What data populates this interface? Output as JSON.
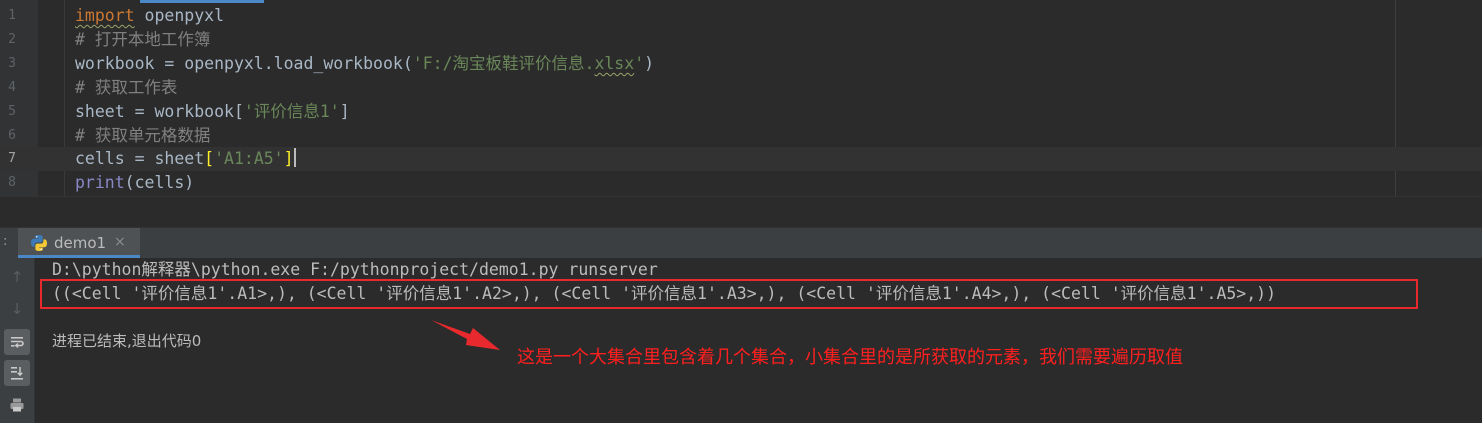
{
  "editor": {
    "lines": [
      {
        "num": "1"
      },
      {
        "num": "2",
        "text": "# 打开本地工作簿"
      },
      {
        "num": "3",
        "before": "workbook = openpyxl.load_workbook(",
        "str_a": "'F:/淘宝板鞋评价信息.",
        "str_b": "xlsx",
        "str_c": "'",
        "after": ")"
      },
      {
        "num": "4",
        "text": "# 获取工作表"
      },
      {
        "num": "5",
        "before": "sheet = workbook[",
        "str": "'评价信息1'",
        "after": "]"
      },
      {
        "num": "6",
        "text": "# 获取单元格数据"
      },
      {
        "num": "7",
        "before": "cells = sheet",
        "open": "[",
        "str": "'A1:A5'",
        "close": "]"
      },
      {
        "num": "8",
        "func": "print",
        "after": "(cells)"
      }
    ],
    "import_kw": "import",
    "import_mod": " openpyxl",
    "current_line": 7
  },
  "run_panel": {
    "colon": ":",
    "tab_label": "demo1",
    "tab_close": "×",
    "icon": "python-icon"
  },
  "toolbar": {
    "up": "↑",
    "down": "↓",
    "wrap": "soft-wrap-icon",
    "scroll_end": "scroll-to-end-icon",
    "print": "print-icon"
  },
  "console": {
    "command": "D:\\python解释器\\python.exe F:/pythonproject/demo1.py runserver",
    "result": "((<Cell '评价信息1'.A1>,), (<Cell '评价信息1'.A2>,), (<Cell '评价信息1'.A3>,), (<Cell '评价信息1'.A4>,), (<Cell '评价信息1'.A5>,))",
    "exit": "进程已结束,退出代码0"
  },
  "annotation": {
    "text": "这是一个大集合里包含着几个集合，小集合里的是所获取的元素，我们需要遍历取值",
    "color": "#ff1f1f"
  },
  "colors": {
    "keyword": "#cc7832",
    "comment": "#808080",
    "string": "#6a8759",
    "builtin": "#8888c6",
    "text": "#a9b7c6",
    "highlight_box": "#e8292d",
    "accent": "#4a88c7"
  }
}
